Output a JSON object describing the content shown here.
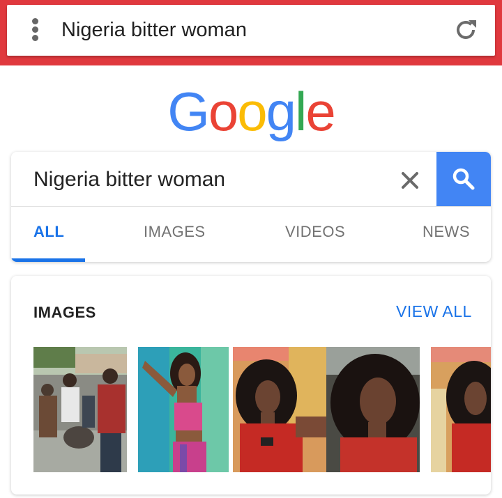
{
  "browser": {
    "omnibox_text": "Nigeria bitter woman",
    "accent_color": "#e0393e"
  },
  "logo": {
    "letters": [
      "G",
      "o",
      "o",
      "g",
      "l",
      "e"
    ],
    "colors": [
      "#4285f4",
      "#ea4335",
      "#fbbc05",
      "#4285f4",
      "#34a853",
      "#ea4335"
    ]
  },
  "search": {
    "query": "Nigeria bitter woman",
    "clear_icon": "close-icon",
    "submit_icon": "search-icon"
  },
  "tabs": [
    {
      "label": "ALL",
      "active": true
    },
    {
      "label": "IMAGES",
      "active": false
    },
    {
      "label": "VIDEOS",
      "active": false
    },
    {
      "label": "NEWS",
      "active": false
    }
  ],
  "images_section": {
    "title": "IMAGES",
    "view_all": "VIEW ALL",
    "thumbnails": [
      {
        "subject": "crowd-street-photo"
      },
      {
        "subject": "woman-colorful-outfit"
      },
      {
        "subject": "woman-red-top-profile"
      },
      {
        "subject": "woman-closeup"
      },
      {
        "subject": "woman-red-top-partial"
      }
    ]
  }
}
